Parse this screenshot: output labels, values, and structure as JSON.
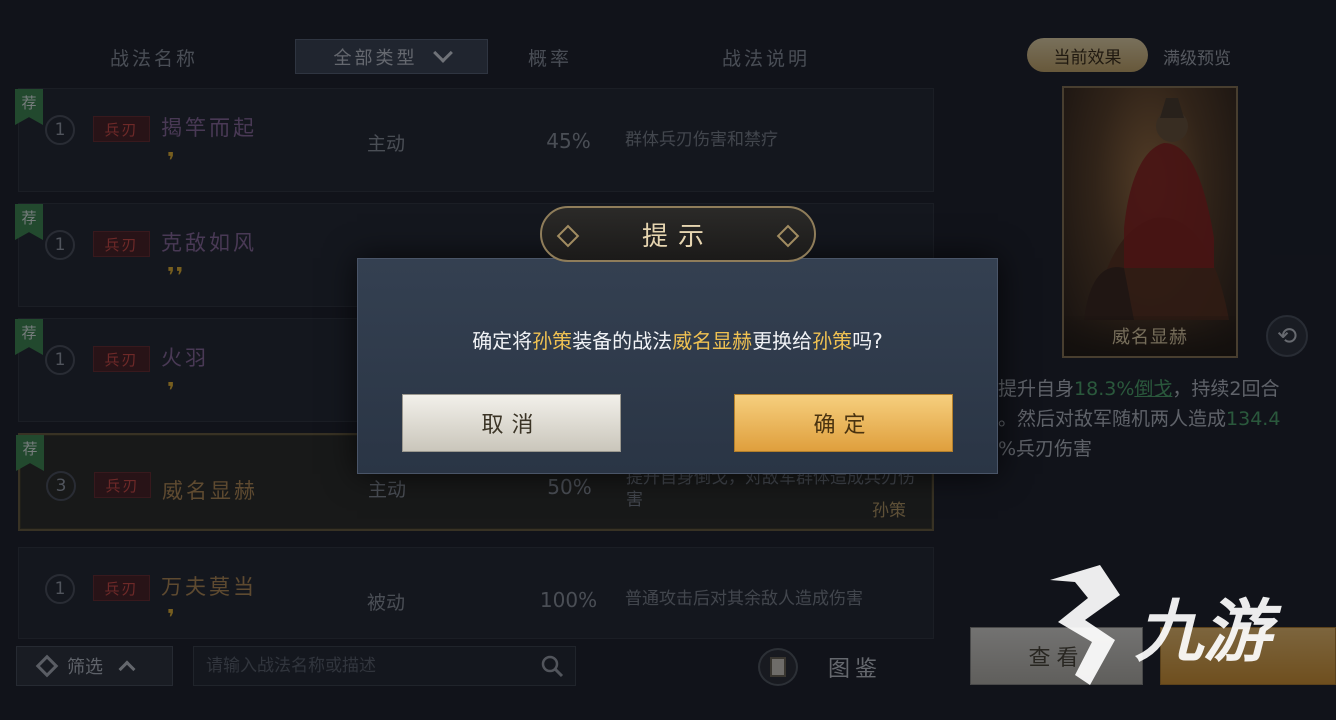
{
  "header": {
    "col_name": "战法名称",
    "type_filter": "全部类型",
    "col_prob": "概率",
    "col_desc": "战法说明"
  },
  "rows": [
    {
      "recommend": "荐",
      "level": "1",
      "tag": "兵刃",
      "name": "揭竿而起",
      "quote": "❜",
      "type": "主动",
      "prob": "45%",
      "desc": "群体兵刃伤害和禁疗",
      "owner": ""
    },
    {
      "recommend": "荐",
      "level": "1",
      "tag": "兵刃",
      "name": "克敌如风",
      "quote": "❜❜",
      "type": "",
      "prob": "",
      "desc": "",
      "owner": ""
    },
    {
      "recommend": "荐",
      "level": "1",
      "tag": "兵刃",
      "name": "火羽",
      "quote": "❜",
      "type": "",
      "prob": "",
      "desc": "",
      "owner": ""
    },
    {
      "recommend": "荐",
      "level": "3",
      "tag": "兵刃",
      "name": "威名显赫",
      "quote": "",
      "type": "主动",
      "prob": "50%",
      "desc": "提升自身倒戈，对敌军群体造成兵刃伤害",
      "owner": "孙策"
    },
    {
      "recommend": "",
      "level": "1",
      "tag": "兵刃",
      "name": "万夫莫当",
      "quote": "❜",
      "type": "被动",
      "prob": "100%",
      "desc": "普通攻击后对其余敌人造成伤害",
      "owner": ""
    }
  ],
  "right_panel": {
    "tab_current": "当前效果",
    "tab_max": "满级预览",
    "card_name": "威名显赫",
    "desc_1": "提升自身",
    "desc_val1": "18.3%",
    "desc_link": "倒戈",
    "desc_2": "，持续2回合",
    "desc_3": "。然后对敌军随机两人造成",
    "desc_val2": "134.4",
    "desc_4": "%兵刃伤害"
  },
  "bottom": {
    "filter_label": "筛选",
    "search_placeholder": "请输入战法名称或描述",
    "atlas_label": "图鉴",
    "view_button": "查看"
  },
  "dialog": {
    "title": "提示",
    "msg_1": "确定将",
    "msg_hero1": "孙策",
    "msg_2": "装备的战法",
    "msg_skill": "威名显赫",
    "msg_3": "更换给",
    "msg_hero2": "孙策",
    "msg_4": "吗?",
    "cancel": "取消",
    "confirm": "确定"
  },
  "watermark": "九游",
  "colors": {
    "accent_gold": "#efc152",
    "recommend_green": "#3f8a4f",
    "tag_red": "#d74a42"
  }
}
